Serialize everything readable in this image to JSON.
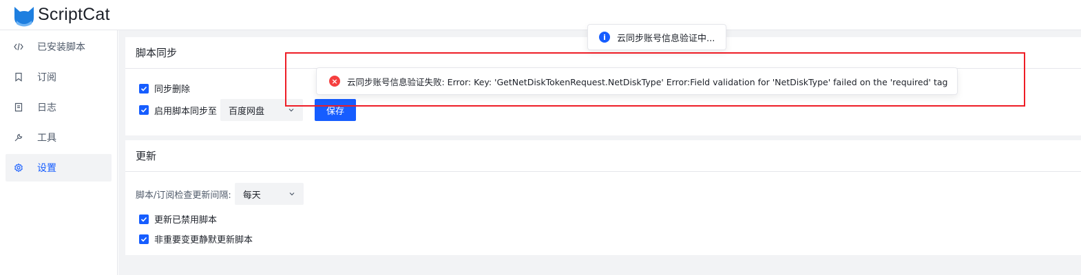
{
  "app": {
    "name": "ScriptCat"
  },
  "sidebar": {
    "items": [
      {
        "label": "已安装脚本",
        "icon": "code-icon"
      },
      {
        "label": "订阅",
        "icon": "bookmark-icon"
      },
      {
        "label": "日志",
        "icon": "file-icon"
      },
      {
        "label": "工具",
        "icon": "wrench-icon"
      },
      {
        "label": "设置",
        "icon": "gear-icon",
        "active": true
      }
    ]
  },
  "sync": {
    "title": "脚本同步",
    "delete_sync_label": "同步删除",
    "delete_sync_checked": true,
    "enable_sync_label": "启用脚本同步至",
    "enable_sync_checked": true,
    "provider_value": "百度网盘",
    "save_label": "保存"
  },
  "update": {
    "title": "更新",
    "interval_label": "脚本/订阅检查更新间隔:",
    "interval_value": "每天",
    "update_disabled_label": "更新已禁用脚本",
    "update_disabled_checked": true,
    "silent_update_label": "非重要变更静默更新脚本",
    "silent_update_checked": true
  },
  "messages": {
    "info": "云同步账号信息验证中...",
    "error": "云同步账号信息验证失败: Error: Key: 'GetNetDiskTokenRequest.NetDiskType' Error:Field validation for 'NetDiskType' failed on the 'required' tag"
  },
  "colors": {
    "accent": "#165dff",
    "error": "#f53f3f",
    "highlight": "#ee1c25"
  }
}
